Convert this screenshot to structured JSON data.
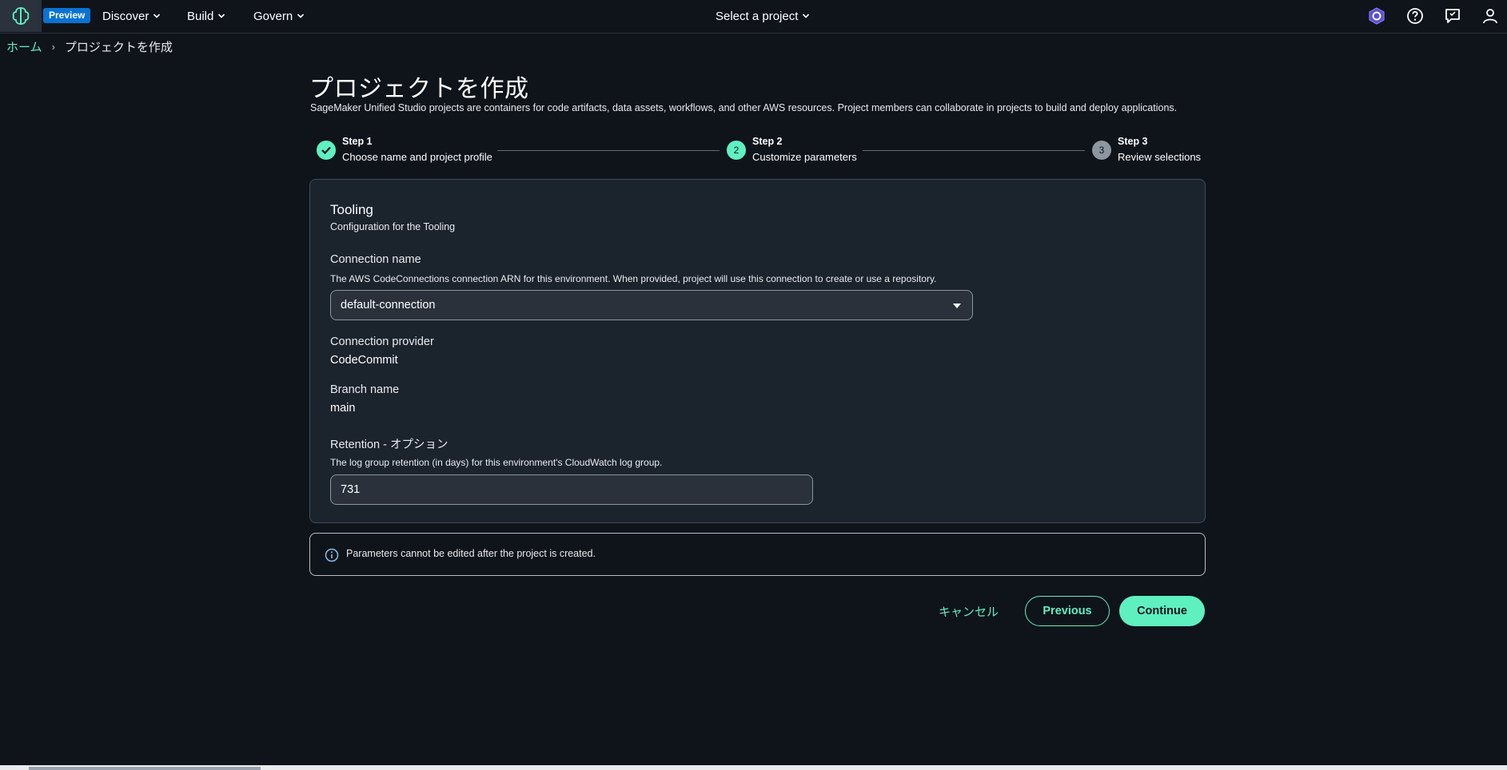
{
  "topnav": {
    "logo_icon": "brain-icon",
    "preview_badge": "Preview",
    "menus": [
      {
        "label": "Discover"
      },
      {
        "label": "Build"
      },
      {
        "label": "Govern"
      }
    ],
    "project_selector": "Select a project",
    "right_icons": [
      "hexagon-badge-icon",
      "help-icon",
      "feedback-icon",
      "user-icon"
    ]
  },
  "breadcrumb": {
    "home": "ホーム",
    "current": "プロジェクトを作成"
  },
  "page": {
    "title": "プロジェクトを作成",
    "description": "SageMaker Unified Studio projects are containers for code artifacts, data assets, workflows, and other AWS resources. Project members can collaborate in projects to build and deploy applications."
  },
  "stepper": {
    "steps": [
      {
        "title": "Step 1",
        "subtitle": "Choose name and project profile",
        "status": "complete"
      },
      {
        "number": "2",
        "title": "Step 2",
        "subtitle": "Customize parameters",
        "status": "current"
      },
      {
        "number": "3",
        "title": "Step 3",
        "subtitle": "Review selections",
        "status": "upcoming"
      }
    ]
  },
  "tooling": {
    "title": "Tooling",
    "subtitle": "Configuration for the Tooling",
    "connection_name": {
      "label": "Connection name",
      "description": "The AWS CodeConnections connection ARN for this environment. When provided, project will use this connection to create or use a repository.",
      "value": "default-connection"
    },
    "connection_provider": {
      "label": "Connection provider",
      "value": "CodeCommit"
    },
    "branch_name": {
      "label": "Branch name",
      "value": "main"
    },
    "retention": {
      "label": "Retention - オプション",
      "description": "The log group retention (in days) for this environment's CloudWatch log group.",
      "value": "731"
    }
  },
  "alert": {
    "icon": "info-icon",
    "text": "Parameters cannot be edited after the project is created."
  },
  "actions": {
    "cancel": "キャンセル",
    "previous": "Previous",
    "continue": "Continue"
  },
  "colors": {
    "accent": "#5ff0c0",
    "background": "#0f141a",
    "panel": "#1b232d",
    "badge": "#0972d3"
  }
}
